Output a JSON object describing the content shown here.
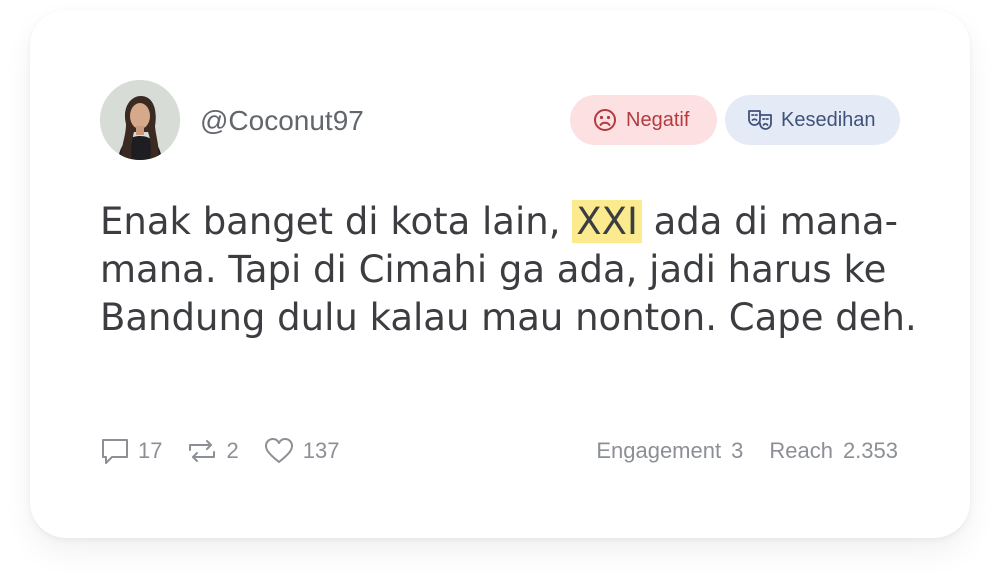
{
  "author": {
    "handle": "@Coconut97"
  },
  "tags": {
    "sentiment": {
      "label": "Negatif",
      "icon": "sad-face-icon",
      "color": "#b33a3f"
    },
    "emotion": {
      "label": "Kesedihan",
      "icon": "theater-masks-icon",
      "color": "#3f527b"
    }
  },
  "post": {
    "text_before": "Enak banget di kota lain, ",
    "highlight": "XXI",
    "text_after": " ada di mana-mana. Tapi di Cimahi ga ada, jadi harus ke Bandung dulu kalau mau nonton. Cape deh.",
    "highlight_color": "#fbeb8e"
  },
  "stats": {
    "comments": "17",
    "retweets": "2",
    "likes": "137"
  },
  "metrics": {
    "engagement_label": "Engagement",
    "engagement_value": "3",
    "reach_label": "Reach",
    "reach_value": "2.353"
  }
}
